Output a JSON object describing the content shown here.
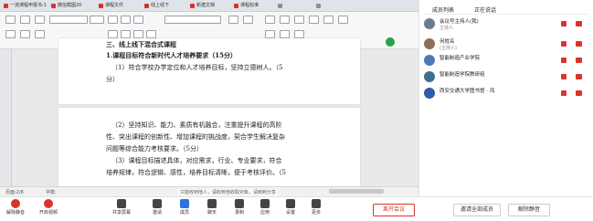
{
  "tabs": [
    {
      "label": "一流课程申报书-1",
      "icon": "doc-icon"
    },
    {
      "label": "微信截图20",
      "icon": "doc-icon"
    },
    {
      "label": "课程文件",
      "icon": "doc-icon"
    },
    {
      "label": "线上线下",
      "icon": "doc-icon"
    },
    {
      "label": "新建文档",
      "icon": "doc-icon"
    },
    {
      "label": "课程标准",
      "icon": "doc-icon"
    },
    {
      "label": "",
      "icon": "doc-icon"
    },
    {
      "label": "",
      "icon": "doc-icon"
    }
  ],
  "document": {
    "page1_lines": [
      "三、线上线下混合式课程",
      "1.课程目标符合新时代人才培养要求（15分）",
      "（1）符合学校办学定位和人才培养目标，坚持立德树人。（5",
      "分）"
    ],
    "page2_lines": [
      "（2）坚持知识、能力、素质有机融合，注重提升课程的高阶",
      "性、突出课程的创新性、增加课程的挑战度，契合学生解决复杂",
      "问题等综合能力考核要求。（5分）",
      "（3）课程目标描述具体，对应需求，行业、专业要求，符合",
      "培养规律，符合逻辑、感性，培养目标清晰，便于考核评价。（5"
    ]
  },
  "statusbar": {
    "page_info": "页面:2/8",
    "words": "字数:",
    "hint": "只能收到他人，请收到他收取对象，请到到分享"
  },
  "panel": {
    "tab_members": "成员列表",
    "tab_speaking": "正在说话",
    "members": [
      {
        "name": "会议号主持人(我)",
        "sub": "主持人",
        "avatar_color": "#6b7d8f"
      },
      {
        "name": "何姓名",
        "sub": "(主持人)",
        "avatar_color": "#8b6f5a"
      },
      {
        "name": "智能制造产业学院",
        "sub": "",
        "avatar_color": "#4a7ab8"
      },
      {
        "name": "智能制造学院教研组",
        "sub": "",
        "avatar_color": "#3c6e8f"
      },
      {
        "name": "西安交通大学图书馆 · 鸿",
        "sub": "",
        "avatar_color": "#2e5aa8"
      }
    ]
  },
  "toolbar": {
    "items": [
      {
        "label": "解除静音",
        "icon": "mic-off-icon"
      },
      {
        "label": "开启视频",
        "icon": "camera-off-icon"
      },
      {
        "label": "共享屏幕",
        "icon": "share-screen-icon"
      },
      {
        "label": "邀请",
        "icon": "invite-icon"
      },
      {
        "label": "成员",
        "icon": "members-icon"
      },
      {
        "label": "聊天",
        "icon": "chat-icon"
      },
      {
        "label": "录制",
        "icon": "record-icon"
      },
      {
        "label": "应用",
        "icon": "apps-icon"
      },
      {
        "label": "设置",
        "icon": "settings-icon"
      },
      {
        "label": "更多",
        "icon": "more-icon"
      }
    ],
    "leave_label": "离开会议",
    "invite_all_label": "邀请全部成员",
    "settings_label": "解除静音"
  },
  "colors": {
    "accent": "#2f6fe0",
    "alert": "#d9342b",
    "panel_bg": "#ffffff"
  }
}
